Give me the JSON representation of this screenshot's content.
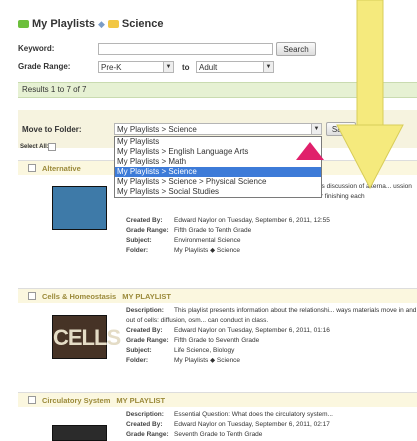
{
  "breadcrumb": {
    "root": "My Playlists",
    "current": "Science"
  },
  "search": {
    "keyword_label": "Keyword:",
    "keyword_value": "",
    "search_button": "Search",
    "grade_label": "Grade Range:",
    "grade_from": "Pre-K",
    "grade_to_label": "to",
    "grade_to": "Adult"
  },
  "results": {
    "text": "Results 1 to 7 of 7"
  },
  "move": {
    "label": "Move to Folder:",
    "selected": "My Playlists > Science",
    "save_button": "Save",
    "select_all_label": "Select All:"
  },
  "dropdown": {
    "options": [
      "My Playlists",
      "My Playlists > English Language Arts",
      "My Playlists > Math",
      "My Playlists > Science",
      "My Playlists > Science > Physical Science",
      "My Playlists > Social Studies"
    ],
    "selected_index": 3
  },
  "playlists": [
    {
      "title": "Alternative",
      "tag": "",
      "description_label": "Description:",
      "description": "class discussion of alterna... ussion after finishing each",
      "created_label": "Created By:",
      "created": "Edward Naylor on Tuesday, September 6, 2011, 12:55",
      "grade_label": "Grade Range:",
      "grade": "Fifth Grade to Tenth Grade",
      "subject_label": "Subject:",
      "subject": "Environmental Science",
      "folder_label": "Folder:",
      "folder": "My Playlists ◆ Science"
    },
    {
      "title": "Cells & Homeostasis",
      "tag": "MY PLAYLIST",
      "thumb_text": "CELLS",
      "description_label": "Description:",
      "description": "This playlist presents information about the relationshi... ways materials move in and out of cells: diffusion, osm... can conduct in class.",
      "created_label": "Created By:",
      "created": "Edward Naylor on Tuesday, September 6, 2011, 01:16",
      "grade_label": "Grade Range:",
      "grade": "Fifth Grade to Seventh Grade",
      "subject_label": "Subject:",
      "subject": "Life Science, Biology",
      "folder_label": "Folder:",
      "folder": "My Playlists ◆ Science"
    },
    {
      "title": "Circulatory System",
      "tag": "MY PLAYLIST",
      "description_label": "Description:",
      "description": "Essential Question: What does the circulatory system...",
      "created_label": "Created By:",
      "created": "Edward Naylor on Tuesday, September 6, 2011, 02:17",
      "grade_label": "Grade Range:",
      "grade": "Seventh Grade to Tenth Grade"
    }
  ],
  "colors": {
    "accent_pink": "#e0206b",
    "arrow_yellow": "#f5ea7d",
    "results_bg": "#e6f1d3"
  }
}
